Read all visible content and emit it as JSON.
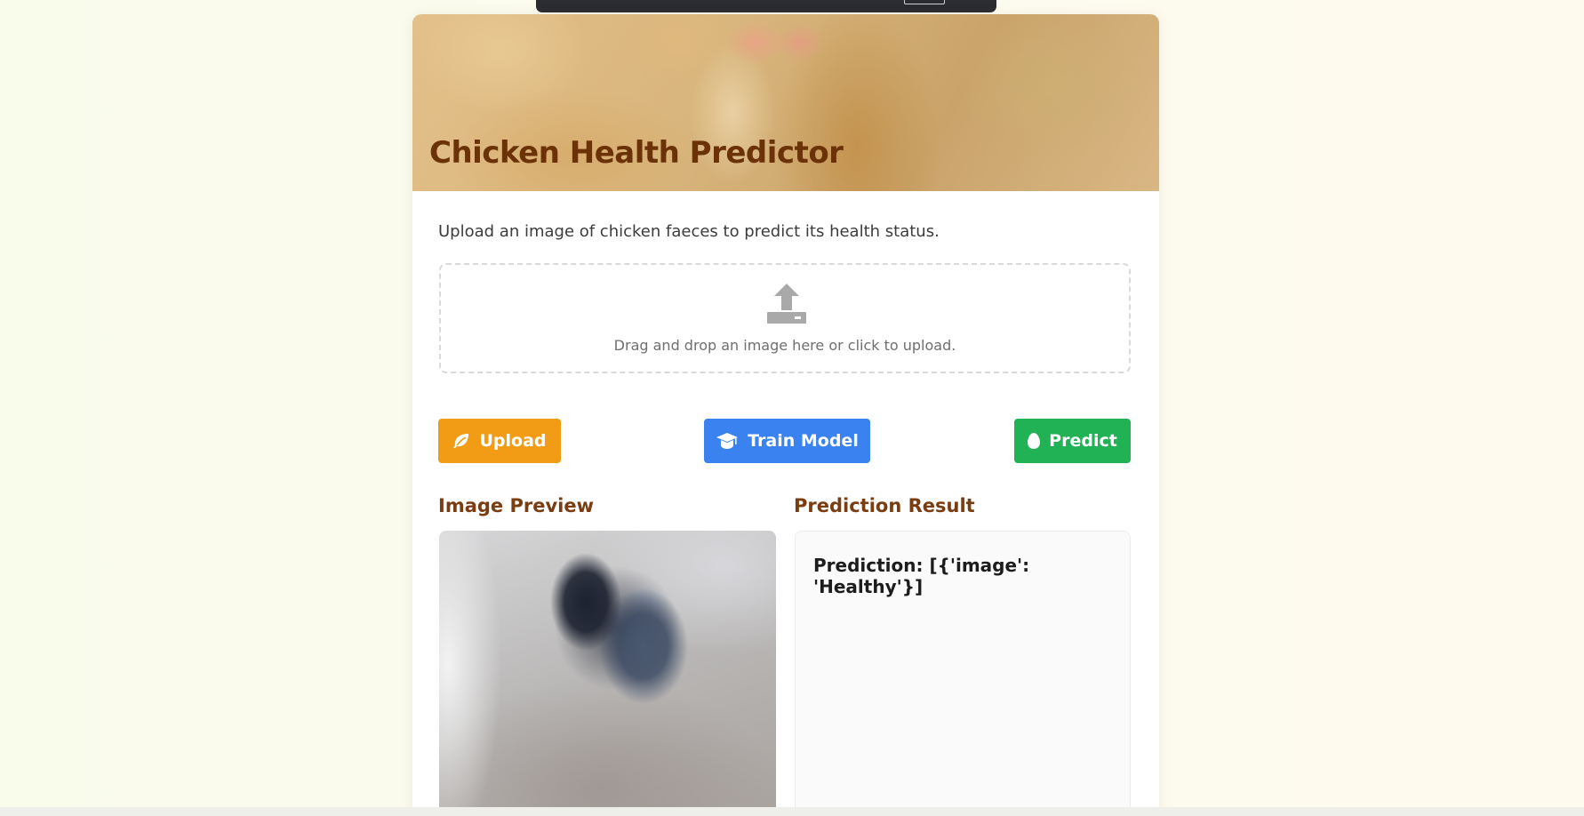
{
  "header": {
    "title": "Chicken Health Predictor"
  },
  "intro": {
    "text": "Upload an image of chicken faeces to predict its health status."
  },
  "dropzone": {
    "text": "Drag and drop an image here or click to upload.",
    "icon": "upload-icon"
  },
  "actions": {
    "upload_label": "Upload",
    "upload_icon": "leaf-icon",
    "train_label": "Train Model",
    "train_icon": "graduation-cap-icon",
    "predict_label": "Predict",
    "predict_icon": "egg-icon"
  },
  "preview": {
    "heading": "Image Preview"
  },
  "result": {
    "heading": "Prediction Result",
    "text": "Prediction: [{'image': 'Healthy'}]"
  },
  "colors": {
    "title": "#6b3107",
    "heading": "#7a3d12",
    "upload_button": "#f19c14",
    "train_button": "#3b82f1",
    "predict_button": "#22b256"
  }
}
